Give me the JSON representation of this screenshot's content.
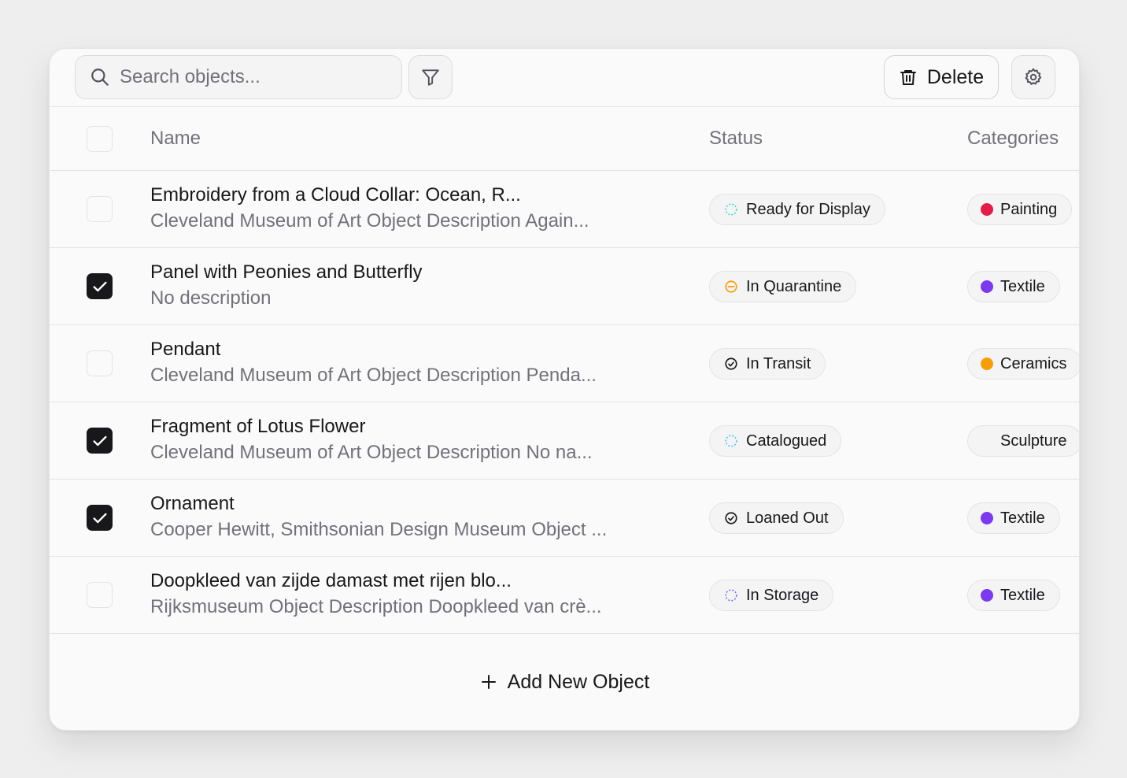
{
  "toolbar": {
    "search_placeholder": "Search objects...",
    "delete_label": "Delete"
  },
  "table": {
    "columns": {
      "name": "Name",
      "status": "Status",
      "categories": "Categories"
    },
    "rows": [
      {
        "checked": false,
        "name": "Embroidery from a Cloud Collar: Ocean, R...",
        "description": "Cleveland Museum of Art Object Description Again...",
        "status": "Ready for Display",
        "status_icon": "dashed-circle-icon",
        "status_color": "#2dd4bf",
        "category": "Painting",
        "category_color": "#e11d48"
      },
      {
        "checked": true,
        "name": "Panel with Peonies and Butterfly",
        "description": "No description",
        "status": "In Quarantine",
        "status_icon": "circle-minus-icon",
        "status_color": "#f59e0b",
        "category": "Textile",
        "category_color": "#7c3aed"
      },
      {
        "checked": false,
        "name": "Pendant",
        "description": "Cleveland Museum of Art Object Description Penda...",
        "status": "In Transit",
        "status_icon": "circle-check-icon",
        "status_color": "#18181b",
        "category": "Ceramics",
        "category_color": "#f59e0b"
      },
      {
        "checked": true,
        "name": "Fragment of Lotus Flower",
        "description": "Cleveland Museum of Art Object Description No na...",
        "status": "Catalogued",
        "status_icon": "dashed-circle-icon",
        "status_color": "#38bdf8",
        "category": "Sculpture",
        "category_color": ""
      },
      {
        "checked": true,
        "name": "Ornament",
        "description": "Cooper Hewitt, Smithsonian Design Museum Object ...",
        "status": "Loaned Out",
        "status_icon": "circle-check-icon",
        "status_color": "#18181b",
        "category": "Textile",
        "category_color": "#7c3aed"
      },
      {
        "checked": false,
        "name": "Doopkleed van zijde damast met rijen blo...",
        "description": "Rijksmuseum Object Description Doopkleed van crè...",
        "status": "In Storage",
        "status_icon": "dashed-circle-icon",
        "status_color": "#6366f1",
        "category": "Textile",
        "category_color": "#7c3aed"
      }
    ]
  },
  "footer": {
    "add_label": "Add New Object"
  }
}
